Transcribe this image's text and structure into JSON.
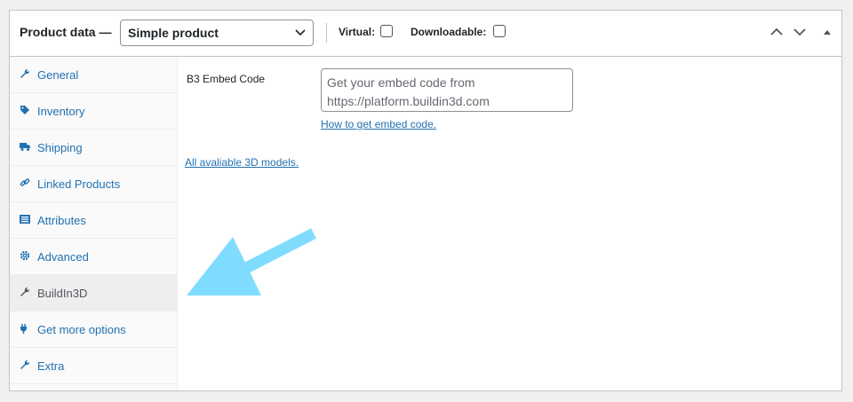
{
  "header": {
    "title": "Product data —",
    "product_type": "Simple product",
    "virtual_label": "Virtual:",
    "downloadable_label": "Downloadable:"
  },
  "tabs": [
    {
      "label": "General",
      "icon": "wrench-icon"
    },
    {
      "label": "Inventory",
      "icon": "tag-icon"
    },
    {
      "label": "Shipping",
      "icon": "truck-icon"
    },
    {
      "label": "Linked Products",
      "icon": "link-icon"
    },
    {
      "label": "Attributes",
      "icon": "list-icon"
    },
    {
      "label": "Advanced",
      "icon": "gear-icon"
    },
    {
      "label": "BuildIn3D",
      "icon": "wrench-icon",
      "active": true
    },
    {
      "label": "Get more options",
      "icon": "plugin-icon"
    },
    {
      "label": "Extra",
      "icon": "wrench-icon"
    }
  ],
  "content": {
    "embed_label": "B3 Embed Code",
    "embed_placeholder": "Get your embed code from https://platform.buildin3d.com",
    "how_to_link": "How to get embed code.",
    "all_models_link": "All avaliable 3D models."
  },
  "colors": {
    "accent": "#2271b1",
    "arrow": "#7fdcff"
  }
}
